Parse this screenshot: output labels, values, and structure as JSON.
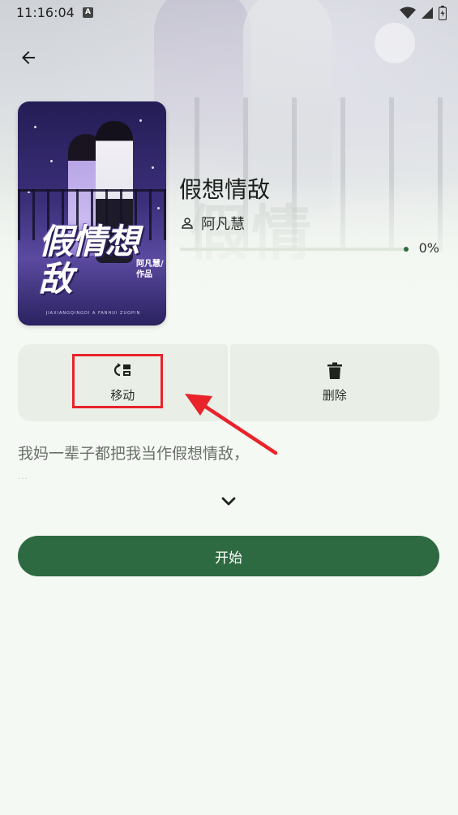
{
  "status_bar": {
    "time": "11:16:04",
    "indicator": "A"
  },
  "book": {
    "title": "假想情敌",
    "author": "阿凡慧",
    "progress_label": "0%",
    "progress_fraction": 0,
    "cover": {
      "title_art": "假情想敌",
      "author_art": "阿凡慧/作品",
      "pinyin_art": "JIAXIANGQINGDI A FANHUI ZUOPIN"
    }
  },
  "actions": {
    "move_label": "移动",
    "delete_label": "删除"
  },
  "description": {
    "text": "我妈一辈子都把我当作假想情敌，",
    "ellipsis": "..."
  },
  "start_label": "开始",
  "colors": {
    "accent": "#2e6a41",
    "background": "#f5f9f3",
    "card": "#e9efe7",
    "annotation": "#e8232a"
  },
  "icons": {
    "back": "arrow-left-icon",
    "author": "person-icon",
    "move": "move-icon",
    "delete": "trash-icon",
    "expand": "chevron-down-icon",
    "wifi": "wifi-icon",
    "signal": "signal-icon",
    "battery": "battery-icon"
  }
}
